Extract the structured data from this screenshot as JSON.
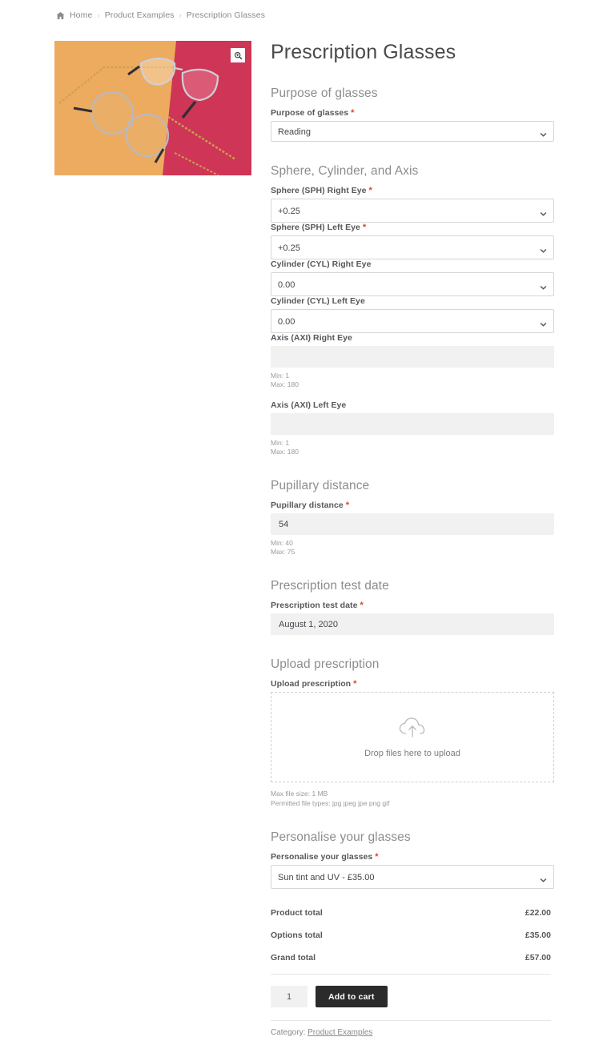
{
  "breadcrumb": {
    "home_icon": "home-icon",
    "items": [
      "Home",
      "Product Examples",
      "Prescription Glasses"
    ],
    "separator": "›"
  },
  "gallery": {
    "zoom_icon": "magnifier-zoom-icon",
    "alt": "Two pairs of prescription glasses on orange and pink background"
  },
  "product": {
    "title": "Prescription Glasses"
  },
  "sections": {
    "purpose": {
      "heading": "Purpose of glasses",
      "label": "Purpose of glasses",
      "required": "*",
      "value": "Reading"
    },
    "sphere": {
      "heading": "Sphere, Cylinder, and Axis",
      "fields": [
        {
          "label": "Sphere (SPH) Right Eye",
          "required": "*",
          "value": "+0.25"
        },
        {
          "label": "Sphere (SPH) Left Eye",
          "required": "*",
          "value": "+0.25"
        },
        {
          "label": "Cylinder (CYL) Right Eye",
          "required": "",
          "value": "0.00"
        },
        {
          "label": "Cylinder (CYL) Left Eye",
          "required": "",
          "value": "0.00"
        }
      ],
      "axis": [
        {
          "label": "Axis (AXI) Right Eye",
          "required": "",
          "value": "",
          "min": "Min: 1",
          "max": "Max: 180"
        },
        {
          "label": "Axis (AXI) Left Eye",
          "required": "",
          "value": "",
          "min": "Min: 1",
          "max": "Max: 180"
        }
      ]
    },
    "pupillary": {
      "heading": "Pupillary distance",
      "label": "Pupillary distance",
      "required": "*",
      "value": "54",
      "min": "Min: 40",
      "max": "Max: 75"
    },
    "test_date": {
      "heading": "Prescription test date",
      "label": "Prescription test date",
      "required": "*",
      "value": "August 1, 2020"
    },
    "upload": {
      "heading": "Upload prescription",
      "label": "Upload prescription",
      "required": "*",
      "dropzone_icon": "cloud-upload-icon",
      "dropzone_text": "Drop files here to upload",
      "max_size": "Max file size: 1 MB",
      "permitted": "Permitted file types: jpg jpeg jpe png gif"
    },
    "personalise": {
      "heading": "Personalise your glasses",
      "label": "Personalise your glasses",
      "required": "*",
      "value": "Sun tint and UV - £35.00"
    }
  },
  "totals": [
    {
      "label": "Product total",
      "amount": "£22.00"
    },
    {
      "label": "Options total",
      "amount": "£35.00"
    },
    {
      "label": "Grand total",
      "amount": "£57.00"
    }
  ],
  "cart": {
    "quantity": "1",
    "add_to_cart_label": "Add to cart"
  },
  "meta": {
    "category_prefix": "Category: ",
    "category_link": "Product Examples"
  },
  "colors": {
    "required_red": "#e2401c",
    "button_dark": "#2b2b2b",
    "input_gray": "#f1f1f1",
    "heading_gray": "#8d8d8d"
  }
}
